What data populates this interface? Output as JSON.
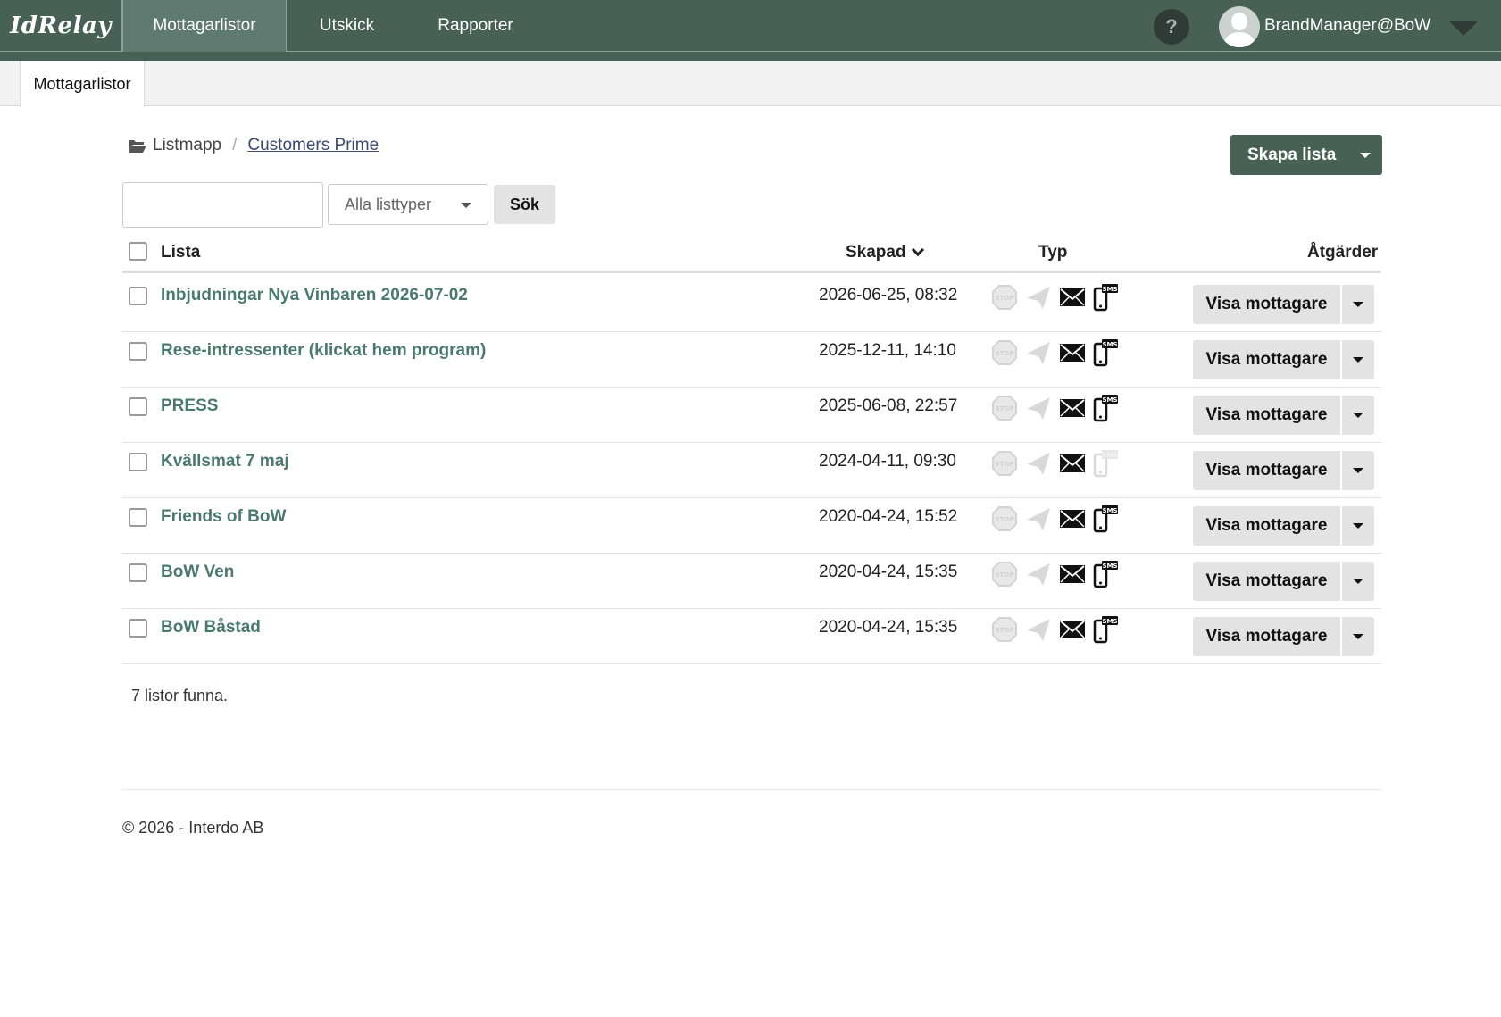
{
  "app": {
    "logo": "IdRelay",
    "nav": [
      "Mottagarlistor",
      "Utskick",
      "Rapporter"
    ],
    "help_label": "?",
    "user": "BrandManager@BoW"
  },
  "subtabs": [
    "Mottagarlistor"
  ],
  "breadcrumb": {
    "root": "Listmapp",
    "separator": "/",
    "current": "Customers Prime"
  },
  "toolbar": {
    "create_label": "Skapa lista",
    "search_value": "",
    "type_select": "Alla listtyper",
    "search_label": "Sök"
  },
  "table": {
    "headers": {
      "name": "Lista",
      "created": "Skapad",
      "type": "Typ",
      "actions": "Åtgärder"
    },
    "rows": [
      {
        "name": "Inbjudningar Nya Vinbaren 2026-07-02",
        "created": "2026-06-25, 08:32",
        "sms": true,
        "action": "Visa mottagare"
      },
      {
        "name": "Rese-intressenter (klickat hem program)",
        "created": "2025-12-11, 14:10",
        "sms": true,
        "action": "Visa mottagare"
      },
      {
        "name": "PRESS",
        "created": "2025-06-08, 22:57",
        "sms": true,
        "action": "Visa mottagare"
      },
      {
        "name": "Kvällsmat 7 maj",
        "created": "2024-04-11, 09:30",
        "sms": false,
        "action": "Visa mottagare"
      },
      {
        "name": "Friends of BoW",
        "created": "2020-04-24, 15:52",
        "sms": true,
        "action": "Visa mottagare"
      },
      {
        "name": "BoW Ven",
        "created": "2020-04-24, 15:35",
        "sms": true,
        "action": "Visa mottagare"
      },
      {
        "name": "BoW Båstad",
        "created": "2020-04-24, 15:35",
        "sms": true,
        "action": "Visa mottagare"
      }
    ],
    "icon_names": [
      "stop-icon",
      "paper-plane-icon",
      "envelope-icon",
      "sms-phone-icon"
    ]
  },
  "found_text": "7 listor funna.",
  "footer": "© 2026 - Interdo AB",
  "colors": {
    "brand": "#486157",
    "link": "#4a7a6c",
    "button_gray": "#e3e3e3"
  }
}
